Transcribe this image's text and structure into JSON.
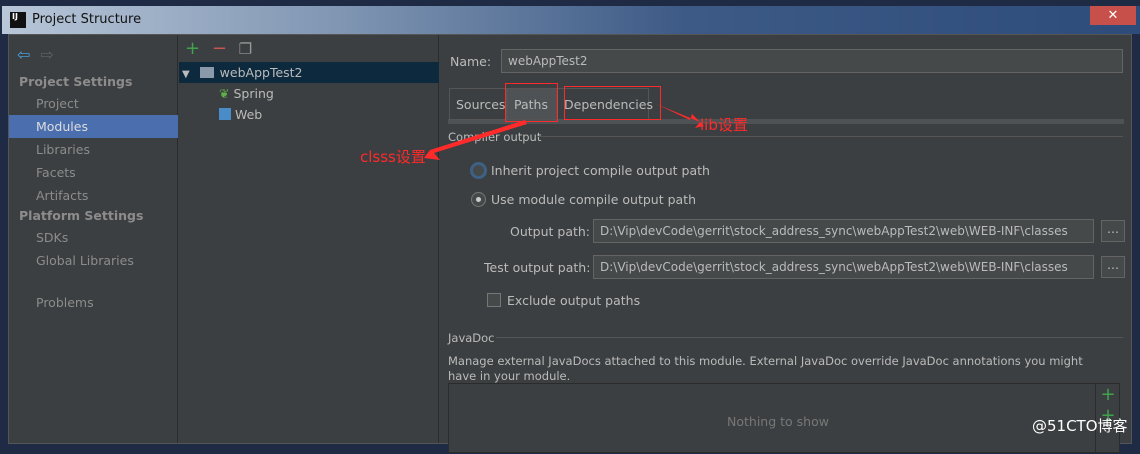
{
  "window": {
    "title": "Project Structure",
    "logo": "IJ",
    "close": "✕"
  },
  "sidebar": {
    "section1": "Project Settings",
    "items1": [
      "Project",
      "Modules",
      "Libraries",
      "Facets",
      "Artifacts"
    ],
    "section2": "Platform Settings",
    "items2": [
      "SDKs",
      "Global Libraries"
    ],
    "problems": "Problems"
  },
  "tree": {
    "root": "webAppTest2",
    "children": [
      "Spring",
      "Web"
    ]
  },
  "main": {
    "name_label": "Name:",
    "name_value": "webAppTest2",
    "tabs": [
      "Sources",
      "Paths",
      "Dependencies"
    ],
    "compiler_output": "Compiler output",
    "inherit": "Inherit project compile output path",
    "use_module": "Use module compile output path",
    "output_label": "Output path:",
    "output_value": "D:\\Vip\\devCode\\gerrit\\stock_address_sync\\webAppTest2\\web\\WEB-INF\\classes",
    "test_label": "Test output path:",
    "test_value": "D:\\Vip\\devCode\\gerrit\\stock_address_sync\\webAppTest2\\web\\WEB-INF\\classes",
    "browse": "...",
    "exclude": "Exclude output paths",
    "javadoc": "JavaDoc",
    "javadoc_desc": "Manage external JavaDocs attached to this module. External JavaDoc override JavaDoc annotations you might have in your module.",
    "empty": "Nothing to show"
  },
  "annotations": {
    "lib": "lib设置",
    "class": "clsss设置",
    "watermark": "@51CTO博客"
  }
}
